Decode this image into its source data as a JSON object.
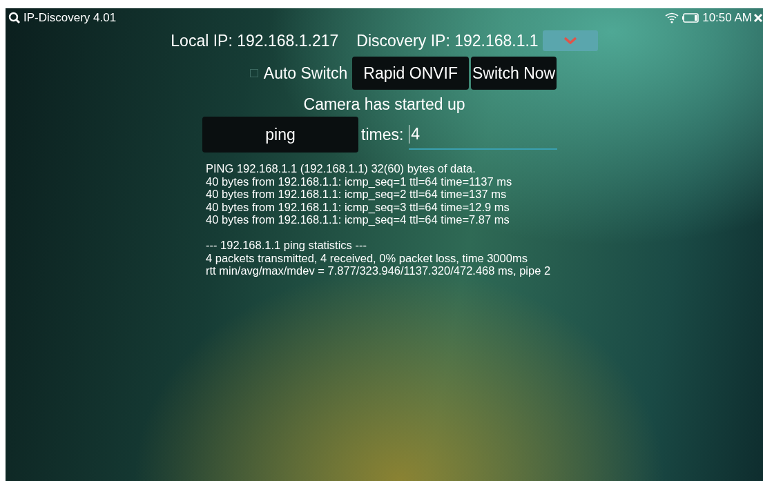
{
  "app_bar": {
    "title": "IP-Discovery 4.01",
    "time": "10:50 AM"
  },
  "ip_row": {
    "local_ip": "Local IP: 192.168.1.217",
    "discovery_ip": "Discovery IP: 192.168.1.1"
  },
  "controls": {
    "auto_switch": {
      "label": "Auto Switch",
      "checked": false
    },
    "buttons": [
      "Rapid ONVIF",
      "Switch Now"
    ]
  },
  "status": "Camera has started up",
  "ping": {
    "button": "ping",
    "times_label": "times:",
    "times_value": "4"
  },
  "output": {
    "reply_lines": [
      "PING 192.168.1.1 (192.168.1.1) 32(60) bytes of data.",
      "40 bytes from 192.168.1.1: icmp_seq=1 ttl=64 time=1137 ms",
      "40 bytes from 192.168.1.1: icmp_seq=2 ttl=64 time=137 ms",
      "40 bytes from 192.168.1.1: icmp_seq=3 ttl=64 time=12.9 ms",
      "40 bytes from 192.168.1.1: icmp_seq=4 ttl=64 time=7.87 ms"
    ],
    "statistics_lines": [
      "--- 192.168.1.1 ping statistics ---",
      "4 packets transmitted, 4 received, 0% packet loss, time 3000ms",
      "rtt min/avg/max/mdev = 7.877/323.946/1137.320/472.468 ms, pipe 2"
    ]
  }
}
